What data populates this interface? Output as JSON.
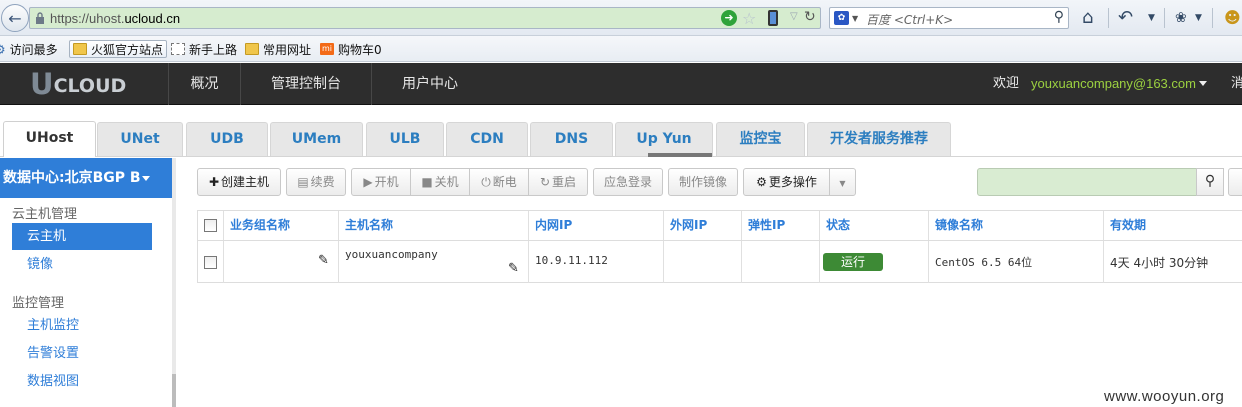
{
  "browser": {
    "url_prefix": "https://uhost.",
    "url_domain": "ucloud.cn",
    "search_placeholder": "百度 <Ctrl+K>",
    "bookmarks": [
      "访问最多",
      "火狐官方站点",
      "新手上路",
      "常用网址",
      "购物车0"
    ]
  },
  "topnav": {
    "logo_initial": "U",
    "logo_rest": "CLOUD",
    "items": [
      "概况",
      "管理控制台",
      "用户中心"
    ],
    "welcome": "欢迎",
    "account": "youxuancompany@163.com",
    "clipped_item": "消"
  },
  "product_tabs": [
    "UHost",
    "UNet",
    "UDB",
    "UMem",
    "ULB",
    "CDN",
    "DNS",
    "Up Yun",
    "监控宝",
    "开发者服务推荐"
  ],
  "sidebar": {
    "datacenter": "数据中心:北京BGP B",
    "groups": [
      {
        "title": "云主机管理",
        "items": [
          "云主机",
          "镜像"
        ]
      },
      {
        "title": "监控管理",
        "items": [
          "主机监控",
          "告警设置",
          "数据视图"
        ]
      }
    ]
  },
  "toolbar": {
    "create": "创建主机",
    "renew": "续费",
    "start": "开机",
    "stop": "关机",
    "power_off": "断电",
    "restart": "重启",
    "emergency_login": "应急登录",
    "make_image": "制作镜像",
    "more": "更多操作"
  },
  "table": {
    "columns": [
      "业务组名称",
      "主机名称",
      "内网IP",
      "外网IP",
      "弹性IP",
      "状态",
      "镜像名称",
      "有效期"
    ],
    "rows": [
      {
        "group": "",
        "host_name": "youxuancompany",
        "private_ip": "10.9.11.112",
        "public_ip": "",
        "elastic_ip": "",
        "status": "运行",
        "image": "CentOS 6.5 64位",
        "validity": "4天 4小时 30分钟"
      }
    ]
  },
  "colors": {
    "accent": "#2f7ed8",
    "status_running": "#3d8a35",
    "nav_bg": "#2d2d2d",
    "account": "#9bd040"
  },
  "watermark": "www.wooyun.org"
}
